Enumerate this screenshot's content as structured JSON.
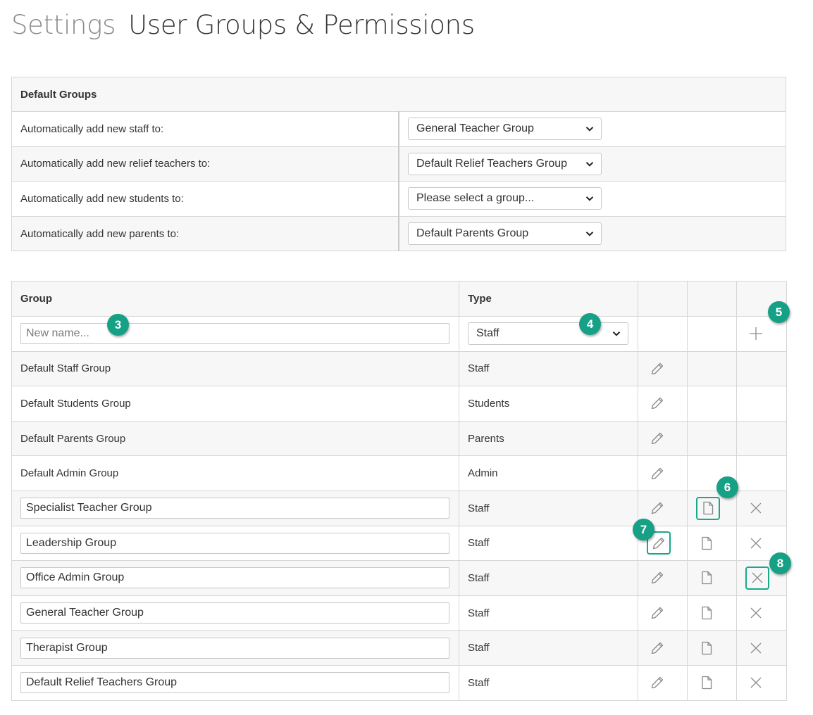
{
  "header": {
    "breadcrumb": "Settings",
    "title": "User Groups & Permissions"
  },
  "default_groups": {
    "heading": "Default Groups",
    "rows": [
      {
        "label": "Automatically add new staff to:",
        "value": "General Teacher Group"
      },
      {
        "label": "Automatically add new relief teachers to:",
        "value": "Default Relief Teachers Group"
      },
      {
        "label": "Automatically add new students to:",
        "value": "Please select a group..."
      },
      {
        "label": "Automatically add new parents to:",
        "value": "Default Parents Group"
      }
    ]
  },
  "groups_table": {
    "col_group": "Group",
    "col_type": "Type",
    "new_row": {
      "name_placeholder": "New name...",
      "type_value": "Staff"
    },
    "rows": [
      {
        "name": "Default Staff Group",
        "type": "Staff"
      },
      {
        "name": "Default Students Group",
        "type": "Students"
      },
      {
        "name": "Default Parents Group",
        "type": "Parents"
      },
      {
        "name": "Default Admin Group",
        "type": "Admin"
      },
      {
        "name": "Specialist Teacher Group",
        "type": "Staff"
      },
      {
        "name": "Leadership Group",
        "type": "Staff"
      },
      {
        "name": "Office Admin Group",
        "type": "Staff"
      },
      {
        "name": "General Teacher Group",
        "type": "Staff"
      },
      {
        "name": "Therapist Group",
        "type": "Staff"
      },
      {
        "name": "Default Relief Teachers Group",
        "type": "Staff"
      }
    ]
  },
  "callouts": [
    "3",
    "4",
    "5",
    "6",
    "7",
    "8"
  ],
  "colors": {
    "accent": "#16a085",
    "border": "#d6d6d6",
    "zebra": "#f7f7f7",
    "icon": "#8c8c8c"
  }
}
